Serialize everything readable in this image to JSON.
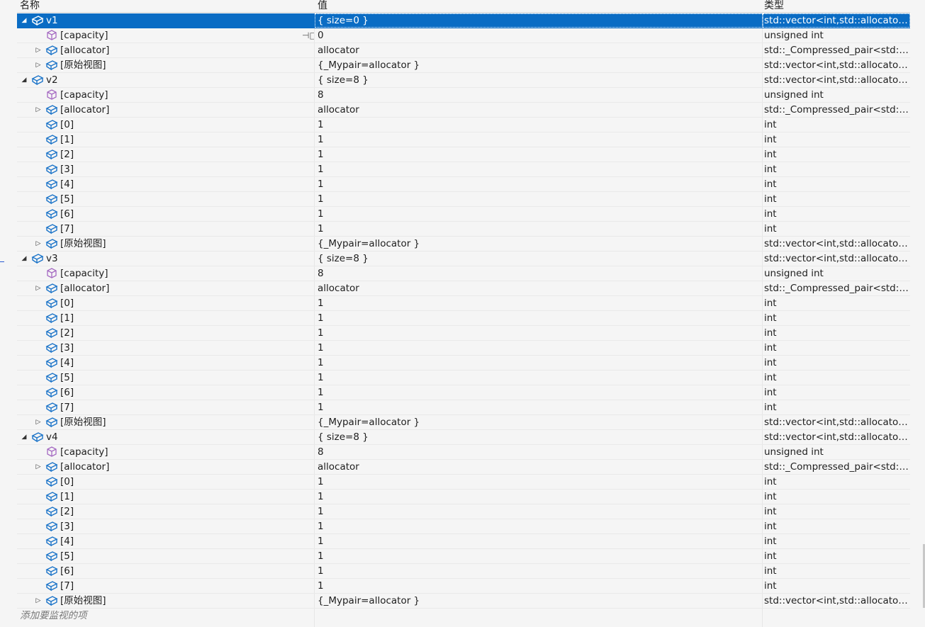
{
  "columns": {
    "name": "名称",
    "value": "值",
    "type": "类型"
  },
  "add_watch_placeholder": "添加要监视的项",
  "colors": {
    "selection": "#0a6cc4",
    "member_icon": "#1a73c8",
    "field_icon": "#a56ac2"
  },
  "rows": [
    {
      "depth": 0,
      "twisty": "expanded",
      "icon": "class-object-icon",
      "name": "v1",
      "value": "{ size=0 }",
      "type": "std::vector<int,std::allocator<i...",
      "selected": true
    },
    {
      "depth": 1,
      "twisty": "none",
      "icon": "field-cube-icon",
      "name": "[capacity]",
      "value": "0",
      "type": "unsigned int",
      "pin": true
    },
    {
      "depth": 1,
      "twisty": "collapsed",
      "icon": "class-object-icon",
      "name": "[allocator]",
      "value": "allocator",
      "type": "std::_Compressed_pair<std::al..."
    },
    {
      "depth": 1,
      "twisty": "collapsed",
      "icon": "class-object-icon",
      "name": "[原始视图]",
      "value": "{_Mypair=allocator }",
      "type": "std::vector<int,std::allocator<i..."
    },
    {
      "depth": 0,
      "twisty": "expanded",
      "icon": "class-object-icon",
      "name": "v2",
      "value": "{ size=8 }",
      "type": "std::vector<int,std::allocator<i..."
    },
    {
      "depth": 1,
      "twisty": "none",
      "icon": "field-cube-icon",
      "name": "[capacity]",
      "value": "8",
      "type": "unsigned int"
    },
    {
      "depth": 1,
      "twisty": "collapsed",
      "icon": "class-object-icon",
      "name": "[allocator]",
      "value": "allocator",
      "type": "std::_Compressed_pair<std::al..."
    },
    {
      "depth": 1,
      "twisty": "none",
      "icon": "class-object-icon",
      "name": "[0]",
      "value": "1",
      "type": "int"
    },
    {
      "depth": 1,
      "twisty": "none",
      "icon": "class-object-icon",
      "name": "[1]",
      "value": "1",
      "type": "int"
    },
    {
      "depth": 1,
      "twisty": "none",
      "icon": "class-object-icon",
      "name": "[2]",
      "value": "1",
      "type": "int"
    },
    {
      "depth": 1,
      "twisty": "none",
      "icon": "class-object-icon",
      "name": "[3]",
      "value": "1",
      "type": "int"
    },
    {
      "depth": 1,
      "twisty": "none",
      "icon": "class-object-icon",
      "name": "[4]",
      "value": "1",
      "type": "int"
    },
    {
      "depth": 1,
      "twisty": "none",
      "icon": "class-object-icon",
      "name": "[5]",
      "value": "1",
      "type": "int"
    },
    {
      "depth": 1,
      "twisty": "none",
      "icon": "class-object-icon",
      "name": "[6]",
      "value": "1",
      "type": "int"
    },
    {
      "depth": 1,
      "twisty": "none",
      "icon": "class-object-icon",
      "name": "[7]",
      "value": "1",
      "type": "int"
    },
    {
      "depth": 1,
      "twisty": "collapsed",
      "icon": "class-object-icon",
      "name": "[原始视图]",
      "value": "{_Mypair=allocator }",
      "type": "std::vector<int,std::allocator<i..."
    },
    {
      "depth": 0,
      "twisty": "expanded",
      "icon": "class-object-icon",
      "name": "v3",
      "value": "{ size=8 }",
      "type": "std::vector<int,std::allocator<i..."
    },
    {
      "depth": 1,
      "twisty": "none",
      "icon": "field-cube-icon",
      "name": "[capacity]",
      "value": "8",
      "type": "unsigned int"
    },
    {
      "depth": 1,
      "twisty": "collapsed",
      "icon": "class-object-icon",
      "name": "[allocator]",
      "value": "allocator",
      "type": "std::_Compressed_pair<std::al..."
    },
    {
      "depth": 1,
      "twisty": "none",
      "icon": "class-object-icon",
      "name": "[0]",
      "value": "1",
      "type": "int"
    },
    {
      "depth": 1,
      "twisty": "none",
      "icon": "class-object-icon",
      "name": "[1]",
      "value": "1",
      "type": "int"
    },
    {
      "depth": 1,
      "twisty": "none",
      "icon": "class-object-icon",
      "name": "[2]",
      "value": "1",
      "type": "int"
    },
    {
      "depth": 1,
      "twisty": "none",
      "icon": "class-object-icon",
      "name": "[3]",
      "value": "1",
      "type": "int"
    },
    {
      "depth": 1,
      "twisty": "none",
      "icon": "class-object-icon",
      "name": "[4]",
      "value": "1",
      "type": "int"
    },
    {
      "depth": 1,
      "twisty": "none",
      "icon": "class-object-icon",
      "name": "[5]",
      "value": "1",
      "type": "int"
    },
    {
      "depth": 1,
      "twisty": "none",
      "icon": "class-object-icon",
      "name": "[6]",
      "value": "1",
      "type": "int"
    },
    {
      "depth": 1,
      "twisty": "none",
      "icon": "class-object-icon",
      "name": "[7]",
      "value": "1",
      "type": "int"
    },
    {
      "depth": 1,
      "twisty": "collapsed",
      "icon": "class-object-icon",
      "name": "[原始视图]",
      "value": "{_Mypair=allocator }",
      "type": "std::vector<int,std::allocator<i..."
    },
    {
      "depth": 0,
      "twisty": "expanded",
      "icon": "class-object-icon",
      "name": "v4",
      "value": "{ size=8 }",
      "type": "std::vector<int,std::allocator<i..."
    },
    {
      "depth": 1,
      "twisty": "none",
      "icon": "field-cube-icon",
      "name": "[capacity]",
      "value": "8",
      "type": "unsigned int"
    },
    {
      "depth": 1,
      "twisty": "collapsed",
      "icon": "class-object-icon",
      "name": "[allocator]",
      "value": "allocator",
      "type": "std::_Compressed_pair<std::al..."
    },
    {
      "depth": 1,
      "twisty": "none",
      "icon": "class-object-icon",
      "name": "[0]",
      "value": "1",
      "type": "int"
    },
    {
      "depth": 1,
      "twisty": "none",
      "icon": "class-object-icon",
      "name": "[1]",
      "value": "1",
      "type": "int"
    },
    {
      "depth": 1,
      "twisty": "none",
      "icon": "class-object-icon",
      "name": "[2]",
      "value": "1",
      "type": "int"
    },
    {
      "depth": 1,
      "twisty": "none",
      "icon": "class-object-icon",
      "name": "[3]",
      "value": "1",
      "type": "int"
    },
    {
      "depth": 1,
      "twisty": "none",
      "icon": "class-object-icon",
      "name": "[4]",
      "value": "1",
      "type": "int"
    },
    {
      "depth": 1,
      "twisty": "none",
      "icon": "class-object-icon",
      "name": "[5]",
      "value": "1",
      "type": "int"
    },
    {
      "depth": 1,
      "twisty": "none",
      "icon": "class-object-icon",
      "name": "[6]",
      "value": "1",
      "type": "int"
    },
    {
      "depth": 1,
      "twisty": "none",
      "icon": "class-object-icon",
      "name": "[7]",
      "value": "1",
      "type": "int"
    },
    {
      "depth": 1,
      "twisty": "collapsed",
      "icon": "class-object-icon",
      "name": "[原始视图]",
      "value": "{_Mypair=allocator }",
      "type": "std::vector<int,std::allocator<i..."
    }
  ]
}
